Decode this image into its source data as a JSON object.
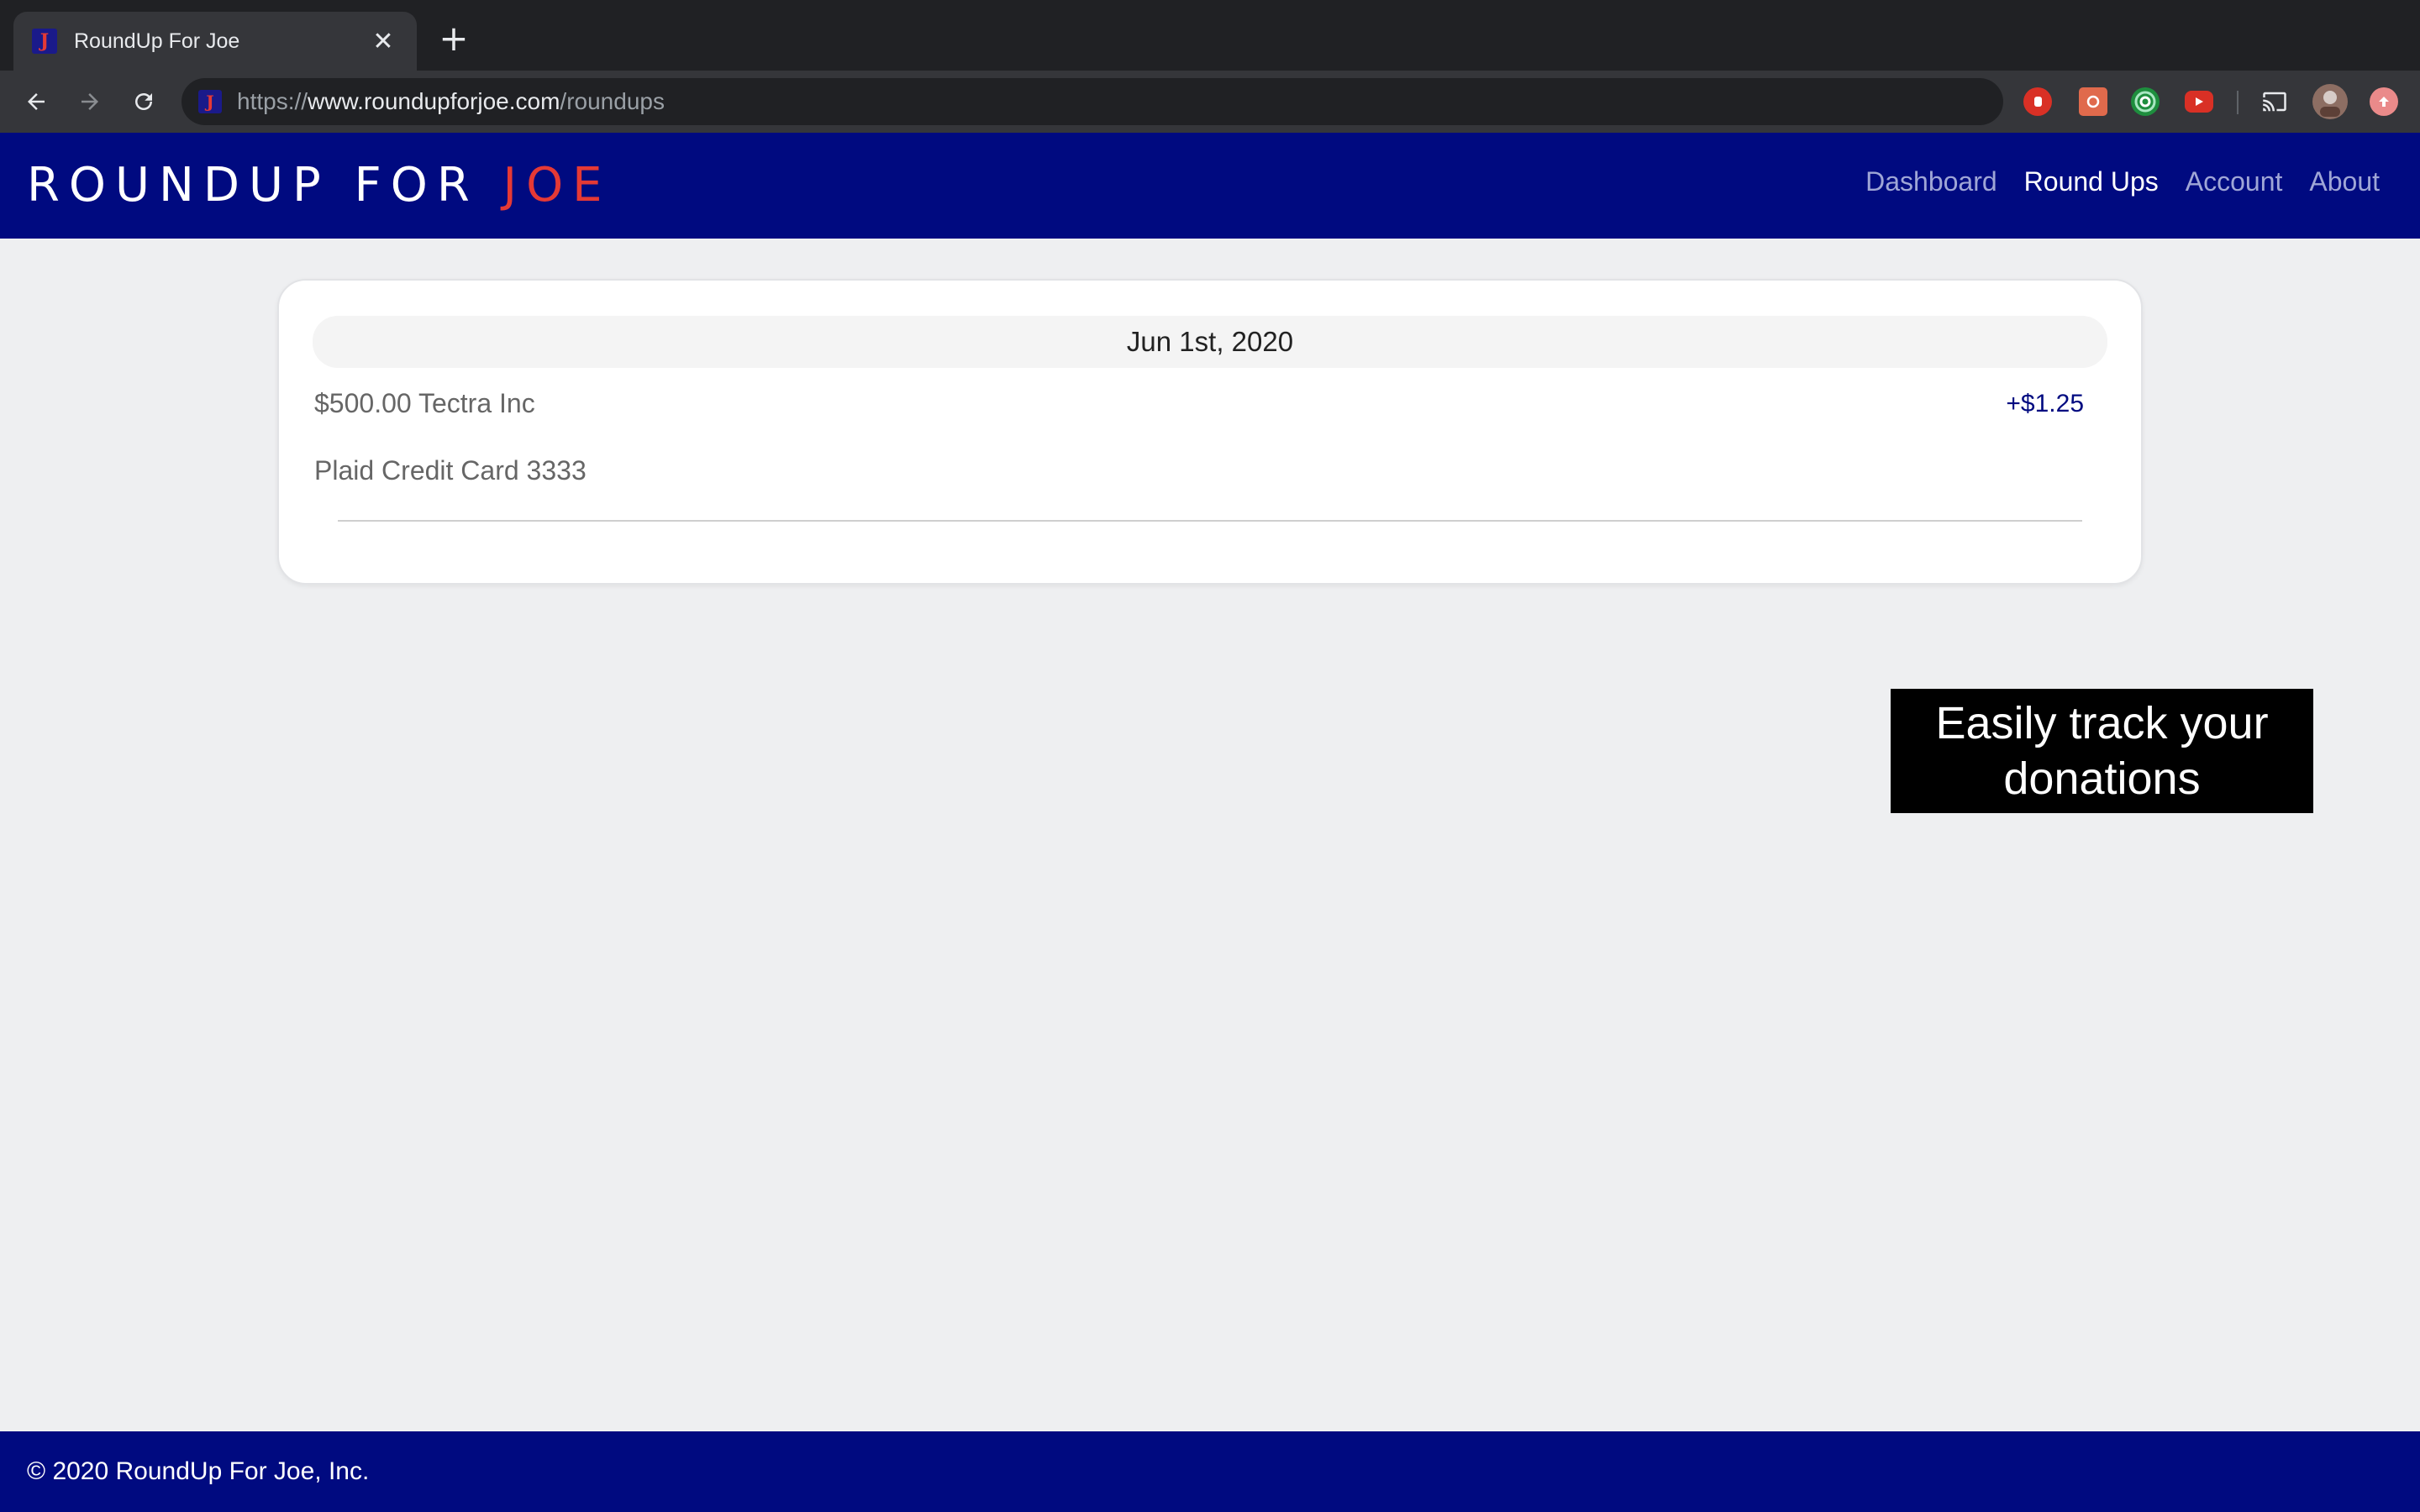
{
  "browser": {
    "tab_title": "RoundUp For Joe",
    "favicon_letter": "J",
    "close_glyph": "✕",
    "new_tab_glyph": "+",
    "url_scheme": "https://",
    "url_host": "www.roundupforjoe.com",
    "url_path": "/roundups",
    "icons": [
      "back-arrow-icon",
      "forward-arrow-icon",
      "reload-icon",
      "hand-stop-extension-icon",
      "puzzle-extension-icon",
      "target-extension-icon",
      "youtube-extension-icon",
      "cast-icon",
      "profile-avatar",
      "update-icon"
    ]
  },
  "navbar": {
    "brand_main": "ROUNDUP FOR ",
    "brand_accent": "JOE",
    "links": [
      {
        "label": "Dashboard"
      },
      {
        "label": "Round Ups"
      },
      {
        "label": "Account"
      },
      {
        "label": "About"
      }
    ],
    "active_link": "Round Ups",
    "color": "#000a80",
    "accent_color": "#e53935"
  },
  "roundups": {
    "date": "Jun 1st, 2020",
    "transaction": {
      "name": "$500.00 Tectra Inc",
      "roundup_amount": "+$1.25",
      "account": "Plaid Credit Card 3333"
    }
  },
  "caption": {
    "line1": "Easily track your",
    "line2": "donations"
  },
  "footer": {
    "copyright": "© 2020 RoundUp For Joe, Inc."
  }
}
